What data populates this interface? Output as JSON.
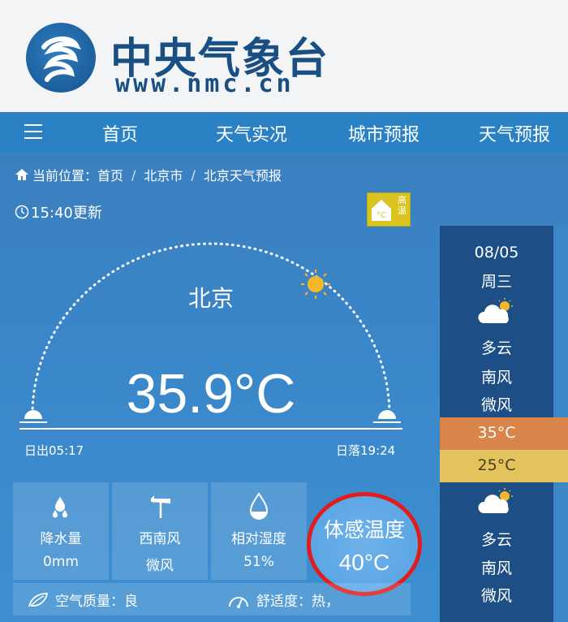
{
  "header": {
    "site_name": "中央气象台",
    "site_url": "www.nmc.cn",
    "brand_color": "#1a4f84"
  },
  "nav": {
    "menu_icon": "hamburger-icon",
    "items": [
      {
        "label": "首页"
      },
      {
        "label": "天气实况"
      },
      {
        "label": "城市预报"
      },
      {
        "label": "天气预报"
      }
    ],
    "bg_color": "#2a82c4"
  },
  "breadcrumb": {
    "prefix": "当前位置：",
    "items": [
      "首页",
      "北京市",
      "北京天气预报"
    ]
  },
  "update_time": "15:40更新",
  "warning": {
    "icon": "high-temperature-warning-icon",
    "text": "高温"
  },
  "current": {
    "city": "北京",
    "temperature": "35.9°C",
    "sunrise": "日出05:17",
    "sunset": "日落19:24"
  },
  "tiles": [
    {
      "icon": "rain-drop-icon",
      "label": "降水量",
      "value": "0mm"
    },
    {
      "icon": "wind-vane-icon",
      "label": "西南风",
      "value": "微风"
    },
    {
      "icon": "humidity-drop-icon",
      "label": "相对湿度",
      "value": "51%"
    }
  ],
  "feels_like": {
    "label": "体感温度",
    "value": "40°C",
    "highlight_color": "#e11c1c"
  },
  "air_quality": {
    "icon": "leaf-icon",
    "text": "空气质量：良"
  },
  "comfort": {
    "icon": "gauge-icon",
    "text": "舒适度：热，"
  },
  "forecast_day": {
    "date": "08/05",
    "weekday": "周三",
    "day": {
      "weather": "多云",
      "wind_dir": "南风",
      "wind_level": "微风",
      "icon": "partly-cloudy-icon"
    },
    "high": "35°C",
    "low": "25°C",
    "night": {
      "weather": "多云",
      "wind_dir": "南风",
      "wind_level": "微风",
      "icon": "partly-cloudy-icon"
    }
  }
}
